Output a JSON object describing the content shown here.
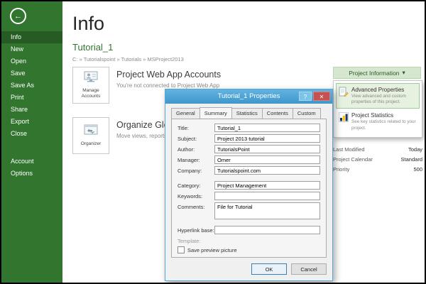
{
  "sidebar": {
    "back_icon": "←",
    "items": [
      {
        "label": "Info"
      },
      {
        "label": "New"
      },
      {
        "label": "Open"
      },
      {
        "label": "Save"
      },
      {
        "label": "Save As"
      },
      {
        "label": "Print"
      },
      {
        "label": "Share"
      },
      {
        "label": "Export"
      },
      {
        "label": "Close"
      },
      {
        "label": "Account"
      },
      {
        "label": "Options"
      }
    ],
    "active_item": "Info"
  },
  "main": {
    "title": "Info",
    "project_name": "Tutorial_1",
    "path": "C: » Tutorialspoint » Tutorials » MSProject2013",
    "sections": [
      {
        "button_label": "Manage Accounts",
        "title": "Project Web App Accounts",
        "description": "You're not connected to Project Web App"
      },
      {
        "button_label": "Organizer",
        "title": "Organize Global T",
        "description": "Move views, reports, and c"
      }
    ]
  },
  "right_panel": {
    "project_information_button": "Project Information",
    "caret": "▾",
    "menu_items": [
      {
        "title": "Advanced Properties",
        "description": "View advanced and custom properties of this project."
      },
      {
        "title": "Project Statistics",
        "description": "See key statistics related to your project."
      }
    ],
    "properties": [
      {
        "label": "Last Modified",
        "value": "Today"
      },
      {
        "label": "Project Calendar",
        "value": "Standard"
      },
      {
        "label": "Priority",
        "value": "500"
      }
    ]
  },
  "dialog": {
    "title": "Tutorial_1 Properties",
    "help_label": "?",
    "close_label": "✕",
    "tabs": [
      {
        "label": "General"
      },
      {
        "label": "Summary"
      },
      {
        "label": "Statistics"
      },
      {
        "label": "Contents"
      },
      {
        "label": "Custom"
      }
    ],
    "active_tab": "Summary",
    "fields": [
      {
        "label": "Title:",
        "value": "Tutorial_1"
      },
      {
        "label": "Subject:",
        "value": "Project 2013 tutorial"
      },
      {
        "label": "Author:",
        "value": "TutorialsPoint"
      },
      {
        "label": "Manager:",
        "value": "Omer"
      },
      {
        "label": "Company:",
        "value": "Tutorialspoint.com"
      },
      {
        "label": "Category:",
        "value": "Project Management"
      },
      {
        "label": "Keywords:",
        "value": ""
      },
      {
        "label": "Comments:",
        "value": "File for Tutorial"
      },
      {
        "label": "Hyperlink base:",
        "value": ""
      },
      {
        "label": "Template:",
        "value": ""
      }
    ],
    "checkbox_label": "Save preview picture",
    "ok_label": "OK",
    "cancel_label": "Cancel"
  },
  "colors": {
    "accent_green": "#31752F",
    "titlebar_blue": "#4aa0d5",
    "close_red": "#c75050"
  }
}
